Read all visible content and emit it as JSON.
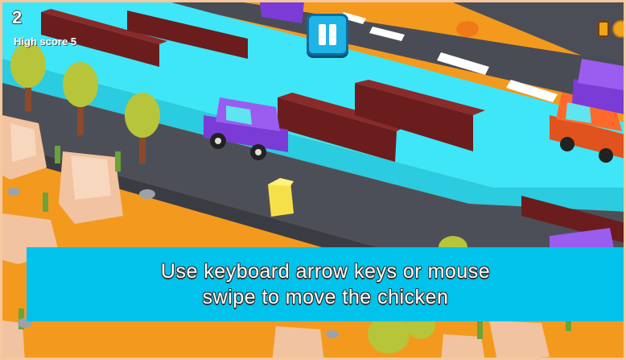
{
  "hud": {
    "score": "2",
    "high_score_label": "High score 5"
  },
  "controls": {
    "pause_icon": "pause-icon",
    "coin_icon": "coin-icon",
    "coin_counter_icon": "battery-icon"
  },
  "instructions": {
    "line1": "Use keyboard arrow keys or mouse",
    "line2": "swipe to move the chicken"
  },
  "colors": {
    "ground": "#f39a1e",
    "road": "#4a4c55",
    "river": "#3ee6f6",
    "banner": "#00c2ea",
    "accent_button": "#1fb4e6"
  }
}
